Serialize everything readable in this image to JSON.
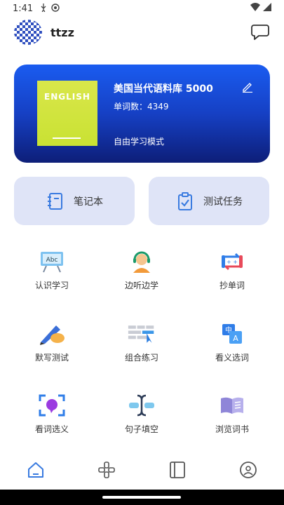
{
  "status_bar": {
    "time": "1:41"
  },
  "header": {
    "username": "ttzz"
  },
  "book": {
    "cover_title": "ENGLISH",
    "name": "美国当代语料库 5000",
    "word_count": "单词数：4349",
    "mode": "自由学习模式"
  },
  "actions": {
    "notebook": "笔记本",
    "tasks": "测试任务"
  },
  "grid": [
    {
      "label": "认识学习",
      "icon": "abc-board-icon"
    },
    {
      "label": "边听边学",
      "icon": "headphones-person-icon"
    },
    {
      "label": "抄单词",
      "icon": "copy-swap-icon"
    },
    {
      "label": "默写测试",
      "icon": "pencil-hand-icon"
    },
    {
      "label": "组合练习",
      "icon": "keyboard-pointer-icon"
    },
    {
      "label": "看义选词",
      "icon": "translate-icon"
    },
    {
      "label": "看词选义",
      "icon": "scan-bubble-icon"
    },
    {
      "label": "句子填空",
      "icon": "text-cursor-icon"
    },
    {
      "label": "浏览词书",
      "icon": "open-book-icon"
    }
  ],
  "nav": [
    "home-icon",
    "gamepad-icon",
    "book-panel-icon",
    "profile-icon"
  ],
  "colors": {
    "card_top": "#1a5cf0",
    "card_bottom": "#0d1e78",
    "action_bg": "#dfe4f7",
    "nav_active": "#3a7be0"
  }
}
